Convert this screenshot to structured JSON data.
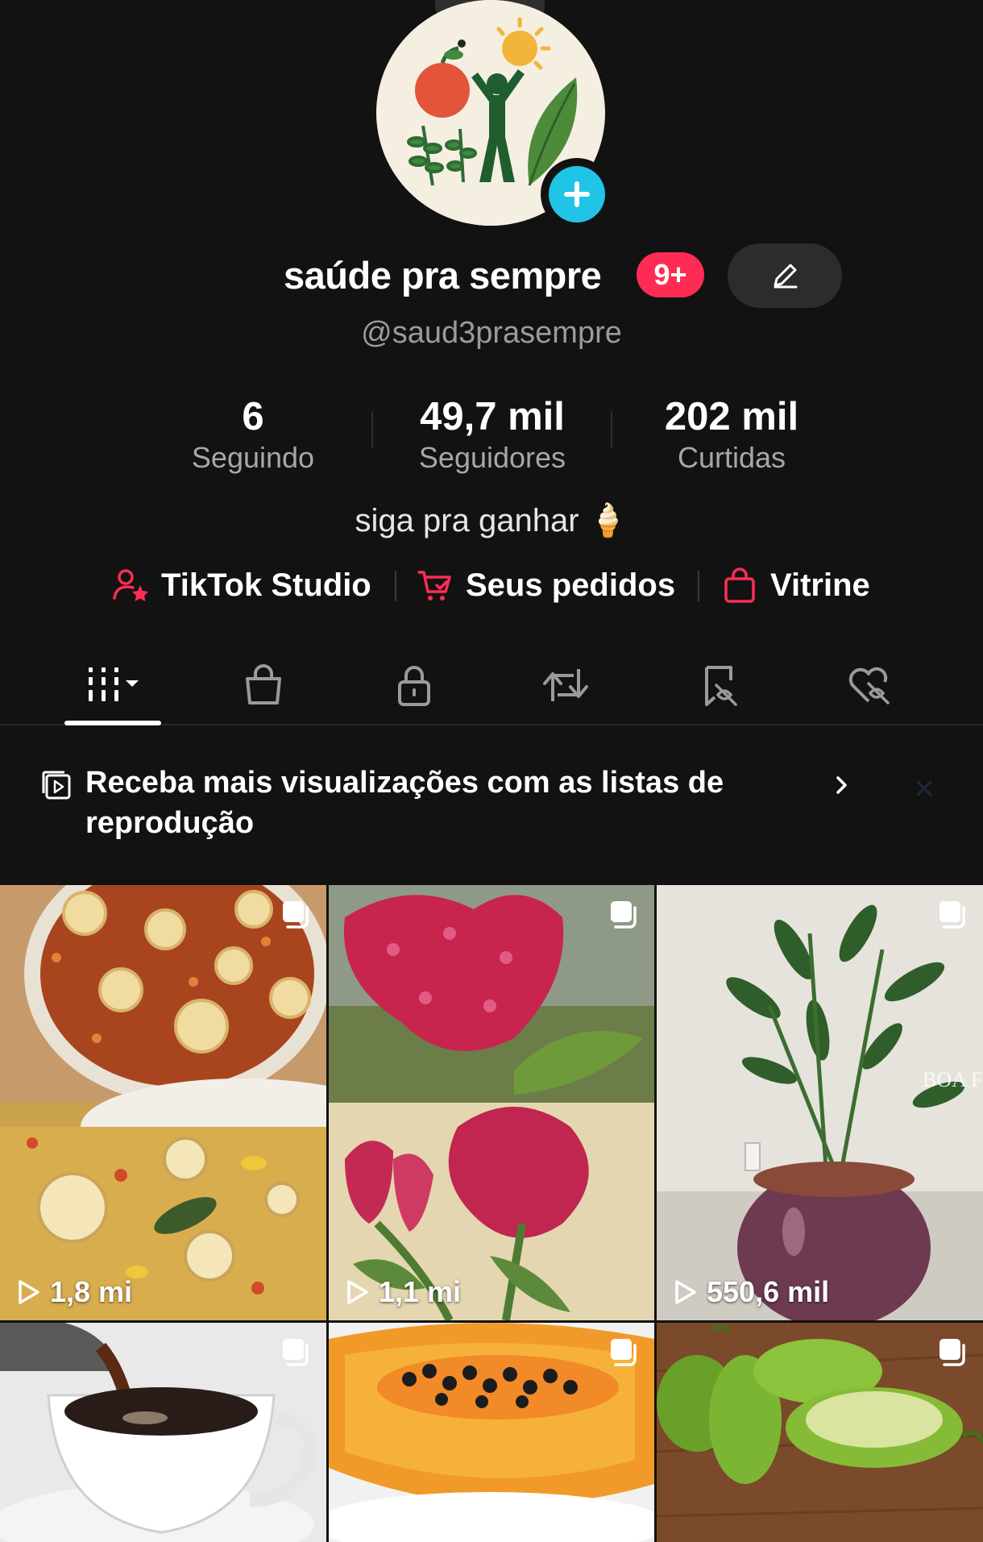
{
  "profile": {
    "display_name": "saúde pra sempre",
    "notification_badge": "9+",
    "handle": "@saud3prasempre",
    "bio": "siga pra ganhar 🍦"
  },
  "stats": [
    {
      "value": "6",
      "label": "Seguindo"
    },
    {
      "value": "49,7 mil",
      "label": "Seguidores"
    },
    {
      "value": "202 mil",
      "label": "Curtidas"
    }
  ],
  "links": [
    {
      "label": "TikTok Studio",
      "icon": "user-star-icon"
    },
    {
      "label": "Seus pedidos",
      "icon": "cart-icon"
    },
    {
      "label": "Vitrine",
      "icon": "shopping-bag-icon"
    }
  ],
  "tabs": [
    {
      "name": "videos-grid",
      "icon": "grid-icon",
      "active": true
    },
    {
      "name": "shop",
      "icon": "bag-icon"
    },
    {
      "name": "private",
      "icon": "lock-icon"
    },
    {
      "name": "reposts",
      "icon": "repost-icon"
    },
    {
      "name": "favorites",
      "icon": "bookmark-hidden-icon"
    },
    {
      "name": "liked",
      "icon": "heart-hidden-icon"
    }
  ],
  "banner": {
    "text": "Receba mais visualizações com as listas de reprodução"
  },
  "grid": {
    "items": [
      {
        "views": "1,8 mi",
        "subject": "stew-with-bones"
      },
      {
        "views": "1,1 mi",
        "subject": "celosia-flower"
      },
      {
        "views": "550,6 mil",
        "subject": "zz-plant-pot"
      },
      {
        "views": "",
        "subject": "coffee-cup"
      },
      {
        "views": "",
        "subject": "papaya"
      },
      {
        "views": "",
        "subject": "green-fruits"
      }
    ]
  },
  "colors": {
    "background": "#121212",
    "accent": "#fe2c55",
    "add_badge": "#20c4e6"
  }
}
